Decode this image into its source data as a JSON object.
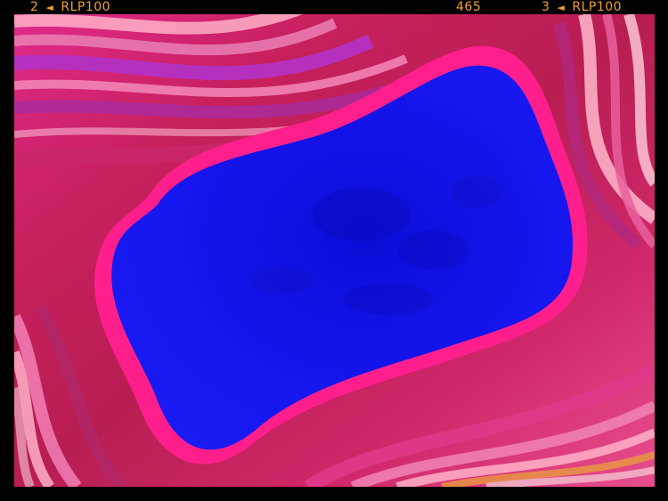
{
  "film_edge": {
    "left_frame": "2",
    "left_arrow": "◄",
    "left_code": "RLP100",
    "center_number": "465",
    "right_frame": "3",
    "right_arrow": "◄",
    "right_code": "RLP100",
    "text_color": "#f2a12a"
  },
  "artwork": {
    "background_color": "#000000",
    "center_color": "#1414f0",
    "band_colors": [
      "#c0205a",
      "#e0308a",
      "#ff3aa8",
      "#b030c0",
      "#f06aa0",
      "#ffb0c8",
      "#e8a020"
    ]
  }
}
